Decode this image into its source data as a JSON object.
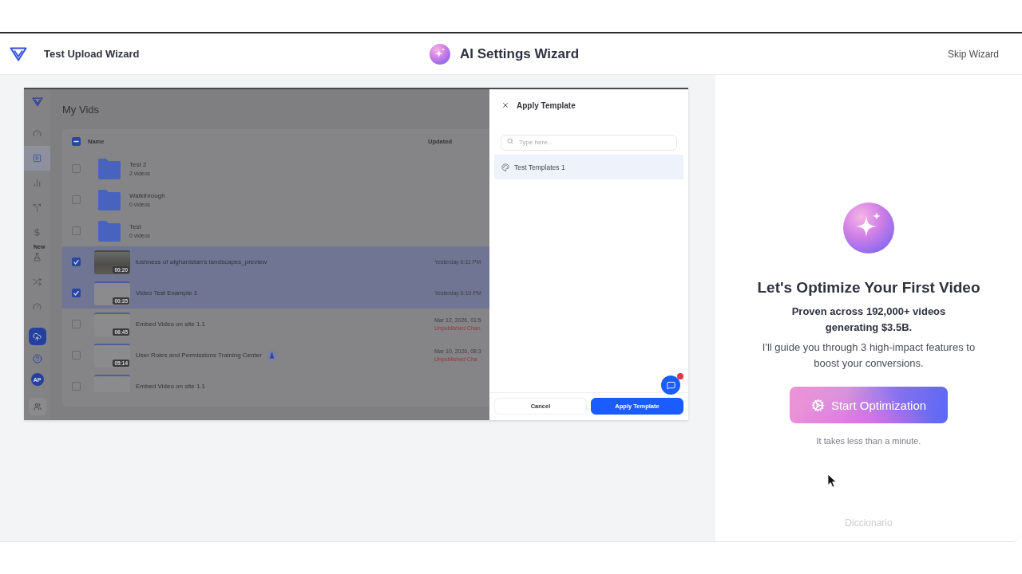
{
  "header": {
    "title": "Test Upload Wizard",
    "wizard_title": "AI Settings Wizard",
    "skip_link": "Skip Wizard"
  },
  "preview": {
    "sidebar": {
      "items": [
        {
          "selected": false
        },
        {
          "selected": true
        },
        {
          "selected": false
        },
        {
          "selected": false
        },
        {
          "selected": false
        },
        {
          "selected": false,
          "badge": "New"
        },
        {
          "selected": false
        },
        {
          "selected": false
        }
      ],
      "avatar": "AP"
    },
    "page_title": "My Vids",
    "table": {
      "columns": [
        "Name",
        "Updated"
      ],
      "select_all": {
        "indeterminate": true
      },
      "rows": [
        {
          "kind": "folder",
          "name": "Test 2",
          "meta": "2 videos",
          "checked": false,
          "selected": false
        },
        {
          "kind": "folder",
          "name": "Walkthrough",
          "meta": "0 videos",
          "checked": false,
          "selected": false
        },
        {
          "kind": "folder",
          "name": "Test",
          "meta": "0 videos",
          "checked": false,
          "selected": false
        },
        {
          "kind": "video",
          "photo": true,
          "name": "lushness of afghanistan's landscapes_preview",
          "duration": "00:20",
          "updated": "Yesterday 6:11 PM",
          "checked": true,
          "selected": true
        },
        {
          "kind": "video",
          "photo": false,
          "name": "Video Test Example 1",
          "duration": "00:35",
          "updated": "Yesterday 6:10 PM",
          "checked": true,
          "selected": true
        },
        {
          "kind": "video",
          "photo": false,
          "name": "Embed Video on site 1.1",
          "duration": "06:45",
          "updated": "Mar 12, 2026, 01:5",
          "status": "Unpublished Chan",
          "checked": false,
          "selected": false
        },
        {
          "kind": "video",
          "photo": false,
          "name": "User Roles and Permissions Training Center",
          "duration": "05:14",
          "updated": "Mar 10, 2026, 08:3",
          "status": "Unpublished Cha",
          "test_badge": true,
          "checked": false,
          "selected": false
        },
        {
          "kind": "video",
          "photo": false,
          "name": "Embed Video on site 1.1",
          "checked": false,
          "selected": false
        }
      ]
    },
    "dialog": {
      "title": "Apply Template",
      "search": {
        "placeholder": "Type here..."
      },
      "templates": [
        {
          "name": "Test Templates 1",
          "selected": true
        }
      ],
      "buttons": [
        {
          "kind": "secondary",
          "label": "Cancel"
        },
        {
          "kind": "primary",
          "label": "Apply Template"
        }
      ],
      "chat": {
        "unread": true
      }
    }
  },
  "intro": {
    "title": "Let's Optimize Your First Video",
    "highlight": "Proven across 192,000+ videos generating $3.5B.",
    "description": "I'll guide you through 3 high-impact features to boost your conversions.",
    "button": "Start Optimization",
    "note": "It takes less than a minute.",
    "footer": "Diccionario"
  }
}
